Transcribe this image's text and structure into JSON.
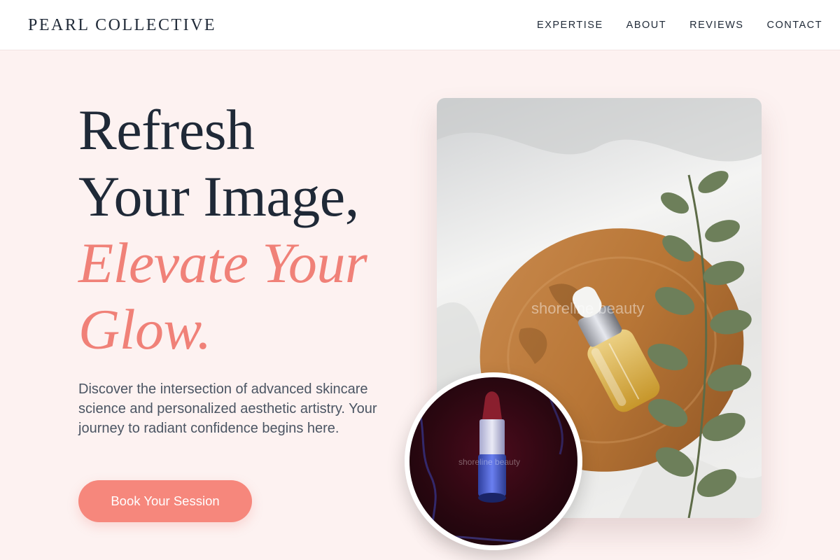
{
  "brand": {
    "logo": "PEARL COLLECTIVE"
  },
  "nav": {
    "items": [
      {
        "label": "EXPERTISE"
      },
      {
        "label": "ABOUT"
      },
      {
        "label": "REVIEWS"
      },
      {
        "label": "CONTACT"
      }
    ]
  },
  "hero": {
    "headline_line1": "Refresh",
    "headline_line2": "Your Image,",
    "headline_accent_line1": "Elevate Your",
    "headline_accent_line2": "Glow.",
    "lead": "Discover the intersection of advanced skincare science and personalized aesthetic artistry. Your journey to radiant confidence begins here.",
    "cta_label": "Book Your Session"
  },
  "images": {
    "main_watermark": "shoreline beauty",
    "round_watermark": "shoreline beauty"
  },
  "colors": {
    "background": "#fdf2f1",
    "accent": "#f08178",
    "button": "#f6877c",
    "text_dark": "#1f2937",
    "text_muted": "#4b5563"
  }
}
